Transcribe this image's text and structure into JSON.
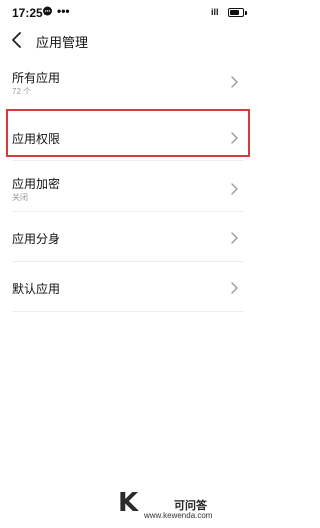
{
  "status_bar": {
    "time": "17:25",
    "dots": "•••",
    "signal": "ill",
    "icons": [
      "message-icon",
      "signal-icon",
      "battery-icon"
    ]
  },
  "header": {
    "title": "应用管理",
    "back_icon": "chevron-left-icon"
  },
  "list": {
    "items": [
      {
        "label": "所有应用",
        "sub": "72 个"
      },
      {
        "label": "应用权限",
        "sub": ""
      },
      {
        "label": "应用加密",
        "sub": "关闭"
      },
      {
        "label": "应用分身",
        "sub": ""
      },
      {
        "label": "默认应用",
        "sub": ""
      }
    ],
    "highlighted_index": 1,
    "highlight_color": "#d43c3c",
    "chevron_icon": "chevron-right-icon"
  },
  "watermark": {
    "letter": "K",
    "title": "可问答",
    "url": "www.kewenda.com"
  }
}
